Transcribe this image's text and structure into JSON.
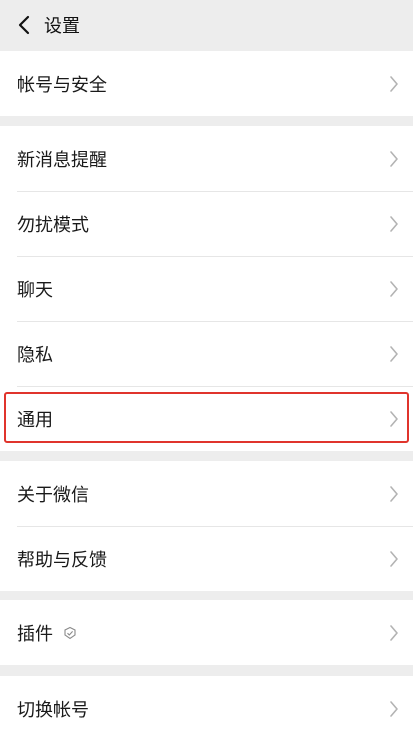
{
  "header": {
    "title": "设置"
  },
  "groups": [
    {
      "items": [
        "帐号与安全"
      ]
    },
    {
      "items": [
        "新消息提醒",
        "勿扰模式",
        "聊天",
        "隐私",
        "通用"
      ]
    },
    {
      "items": [
        "关于微信",
        "帮助与反馈"
      ]
    },
    {
      "items": [
        "插件"
      ]
    },
    {
      "items": [
        "切换帐号"
      ]
    }
  ],
  "highlight": {
    "item": "通用",
    "color": "#e0342c"
  },
  "icons": {
    "back": "chevron-left-icon",
    "row": "chevron-right-icon",
    "plugin": "plugin-badge-icon"
  }
}
